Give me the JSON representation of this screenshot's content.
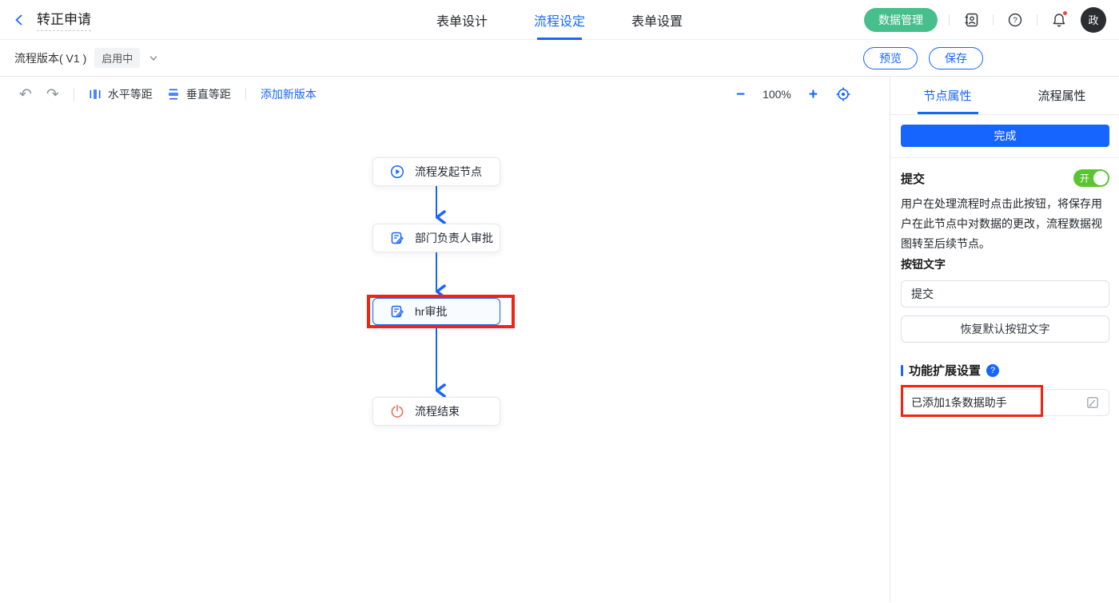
{
  "header": {
    "title": "转正申请",
    "tabs": [
      {
        "label": "表单设计",
        "active": false
      },
      {
        "label": "流程设定",
        "active": true
      },
      {
        "label": "表单设置",
        "active": false
      }
    ],
    "data_manage_label": "数据管理",
    "avatar_text": "政",
    "icons": [
      "contact-book-icon",
      "help-icon",
      "bell-icon"
    ]
  },
  "version_bar": {
    "label": "流程版本( V1 )",
    "status_badge": "启用中",
    "preview_label": "预览",
    "save_label": "保存"
  },
  "toolbar": {
    "horizontal_spacing_label": "水平等距",
    "vertical_spacing_label": "垂直等距",
    "add_version_label": "添加新版本",
    "zoom_level": "100%"
  },
  "flow": {
    "nodes": [
      {
        "label": "流程发起节点",
        "type": "start",
        "selected": false
      },
      {
        "label": "部门负责人审批",
        "type": "approval",
        "selected": false
      },
      {
        "label": "hr审批",
        "type": "approval",
        "selected": true,
        "highlighted": true
      },
      {
        "label": "流程结束",
        "type": "end",
        "selected": false
      }
    ]
  },
  "panel": {
    "tabs": [
      {
        "label": "节点属性",
        "active": true
      },
      {
        "label": "流程属性",
        "active": false
      }
    ],
    "complete_button_label": "完成",
    "submit": {
      "label": "提交",
      "toggle_state": "开",
      "description": "用户在处理流程时点击此按钮，将保存用户在此节点中对数据的更改，流程数据视图转至后续节点。",
      "button_text_label": "按钮文字",
      "button_text_value": "提交",
      "restore_button_label": "恢复默认按钮文字"
    },
    "extension": {
      "title": "功能扩展设置",
      "data_assist_text": "已添加1条数据助手"
    }
  },
  "colors": {
    "primary_blue": "#1765ff",
    "data_manage_green": "#47be8d",
    "toggle_green": "#5bc531",
    "annotation_red": "#f02410",
    "end_node_red": "#f06e5e"
  }
}
